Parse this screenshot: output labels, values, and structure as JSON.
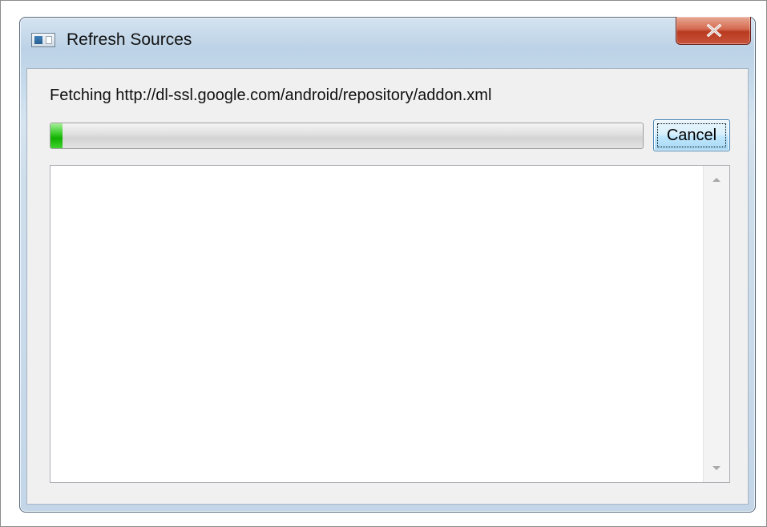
{
  "window": {
    "title": "Refresh Sources",
    "icon": "window-app-icon",
    "close_icon": "close-x-icon"
  },
  "status": {
    "text": "Fetching http://dl-ssl.google.com/android/repository/addon.xml"
  },
  "progress": {
    "value_fraction": 0.02,
    "color": "#11b000"
  },
  "buttons": {
    "cancel_label": "Cancel"
  },
  "log": {
    "content": "",
    "scroll_up_icon": "scroll-up-arrow-icon",
    "scroll_down_icon": "scroll-down-arrow-icon"
  },
  "colors": {
    "close_button": "#c7533a",
    "focused_button_border": "#3c7fb1"
  }
}
